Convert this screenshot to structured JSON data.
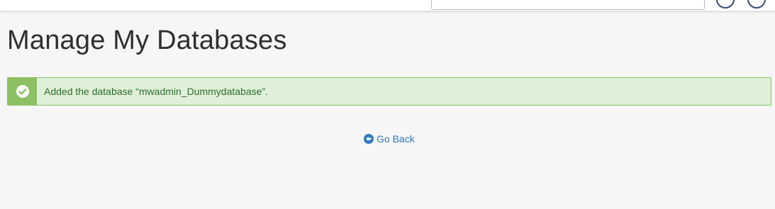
{
  "page": {
    "title": "Manage My Databases"
  },
  "alert": {
    "type": "success",
    "message": "Added the database “mwadmin_Dummydatabase”.",
    "icon": "check-circle-icon"
  },
  "actions": {
    "go_back_label": "Go Back",
    "go_back_icon": "arrow-circle-left-icon"
  },
  "colors": {
    "success_bg": "#dff0d8",
    "success_border": "#8cc063",
    "success_text": "#2f6b2f",
    "link": "#2f7bbd",
    "page_bg": "#f6f6f6"
  }
}
